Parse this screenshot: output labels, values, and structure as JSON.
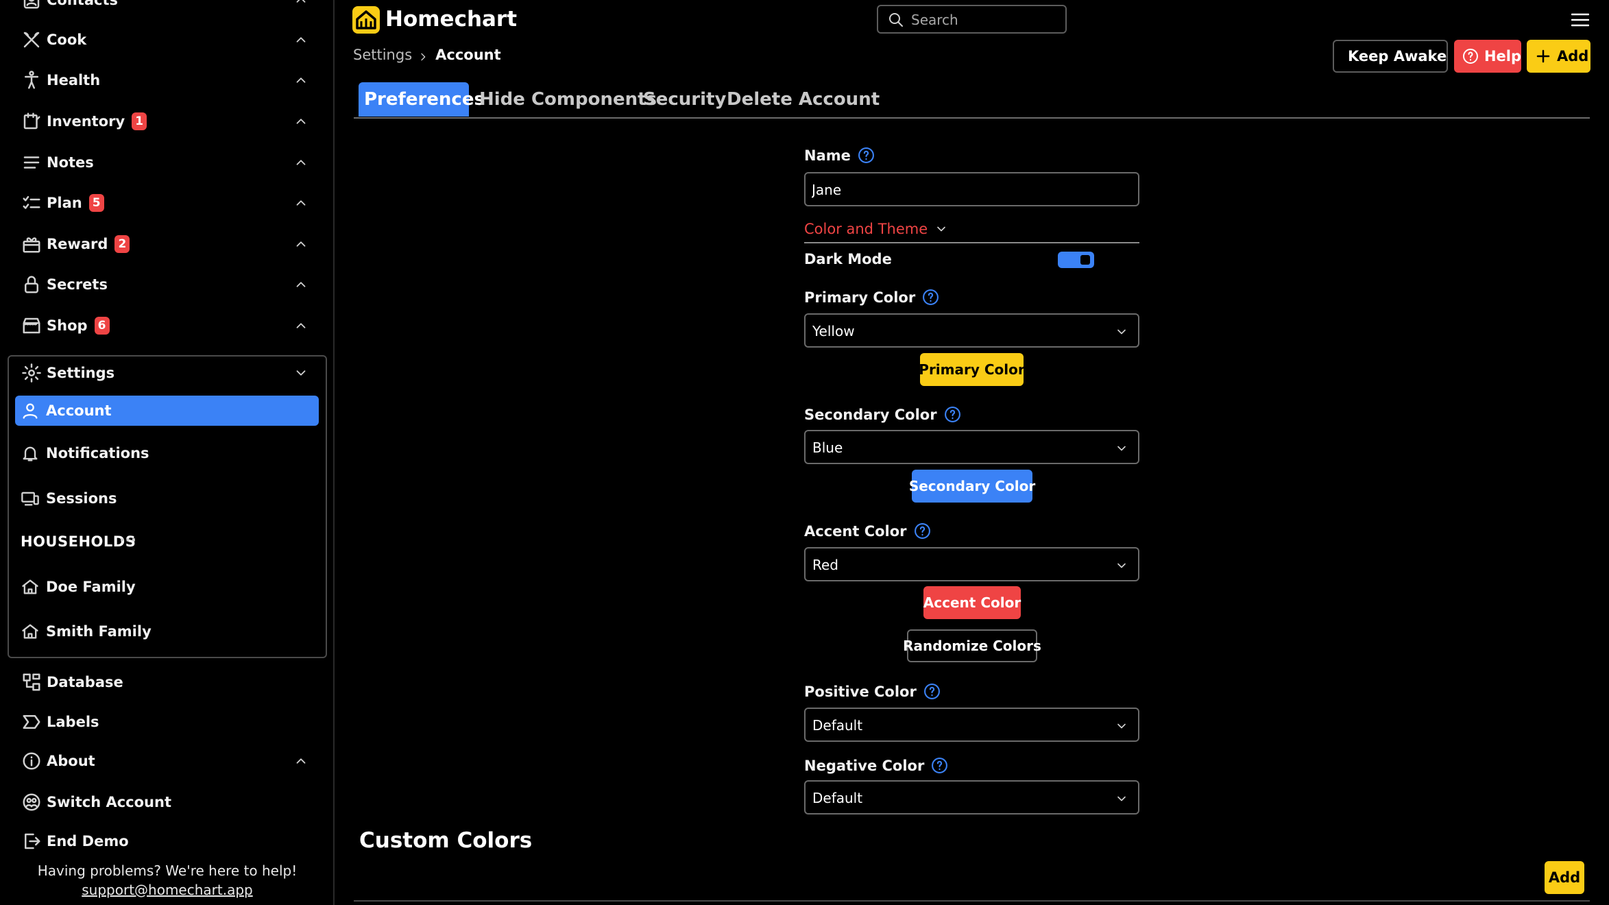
{
  "app": {
    "title": "Homechart"
  },
  "search": {
    "placeholder": "Search"
  },
  "breadcrumb": {
    "parent": "Settings",
    "current": "Account"
  },
  "header_buttons": {
    "keep_awake": "Keep Awake",
    "help": "Help",
    "add": "Add"
  },
  "colors": {
    "primary": "#facc15",
    "secondary": "#3b82f6",
    "accent": "#ef4444"
  },
  "sidebar": {
    "top_items": [
      {
        "label": "Contacts",
        "icon": "contacts-icon"
      },
      {
        "label": "Cook",
        "icon": "cook-icon"
      },
      {
        "label": "Health",
        "icon": "health-icon"
      },
      {
        "label": "Inventory",
        "icon": "inventory-icon",
        "badge": "1"
      },
      {
        "label": "Notes",
        "icon": "notes-icon"
      },
      {
        "label": "Plan",
        "icon": "plan-icon",
        "badge": "5"
      },
      {
        "label": "Reward",
        "icon": "reward-icon",
        "badge": "2"
      },
      {
        "label": "Secrets",
        "icon": "lock-icon"
      },
      {
        "label": "Shop",
        "icon": "shop-icon",
        "badge": "6"
      }
    ],
    "settings": {
      "label": "Settings",
      "items": [
        {
          "label": "Account",
          "active": true
        },
        {
          "label": "Notifications"
        },
        {
          "label": "Sessions"
        }
      ],
      "households_label": "HOUSEHOLDS",
      "households_more": "···",
      "households": [
        {
          "label": "Doe Family"
        },
        {
          "label": "Smith Family"
        }
      ]
    },
    "bottom_items": [
      {
        "label": "Database"
      },
      {
        "label": "Labels"
      },
      {
        "label": "About"
      },
      {
        "label": "Switch Account"
      },
      {
        "label": "End Demo"
      }
    ],
    "help_text": "Having problems? We're here to help!",
    "help_email": "support@homechart.app"
  },
  "tabs": [
    {
      "label": "Preferences",
      "active": true
    },
    {
      "label": "Hide Components"
    },
    {
      "label": "Security"
    },
    {
      "label": "Delete Account"
    }
  ],
  "form": {
    "name_label": "Name",
    "name_value": "Jane",
    "theme_section": "Color and Theme",
    "dark_mode_label": "Dark Mode",
    "dark_mode": true,
    "primary_color_label": "Primary Color",
    "primary_color_value": "Yellow",
    "primary_color_button": "Primary Color",
    "secondary_color_label": "Secondary Color",
    "secondary_color_value": "Blue",
    "secondary_color_button": "Secondary Color",
    "accent_color_label": "Accent Color",
    "accent_color_value": "Red",
    "accent_color_button": "Accent Color",
    "randomize_button": "Randomize Colors",
    "positive_color_label": "Positive Color",
    "positive_color_value": "Default",
    "negative_color_label": "Negative Color",
    "negative_color_value": "Default"
  },
  "custom_colors": {
    "title": "Custom Colors",
    "add_button": "Add"
  }
}
